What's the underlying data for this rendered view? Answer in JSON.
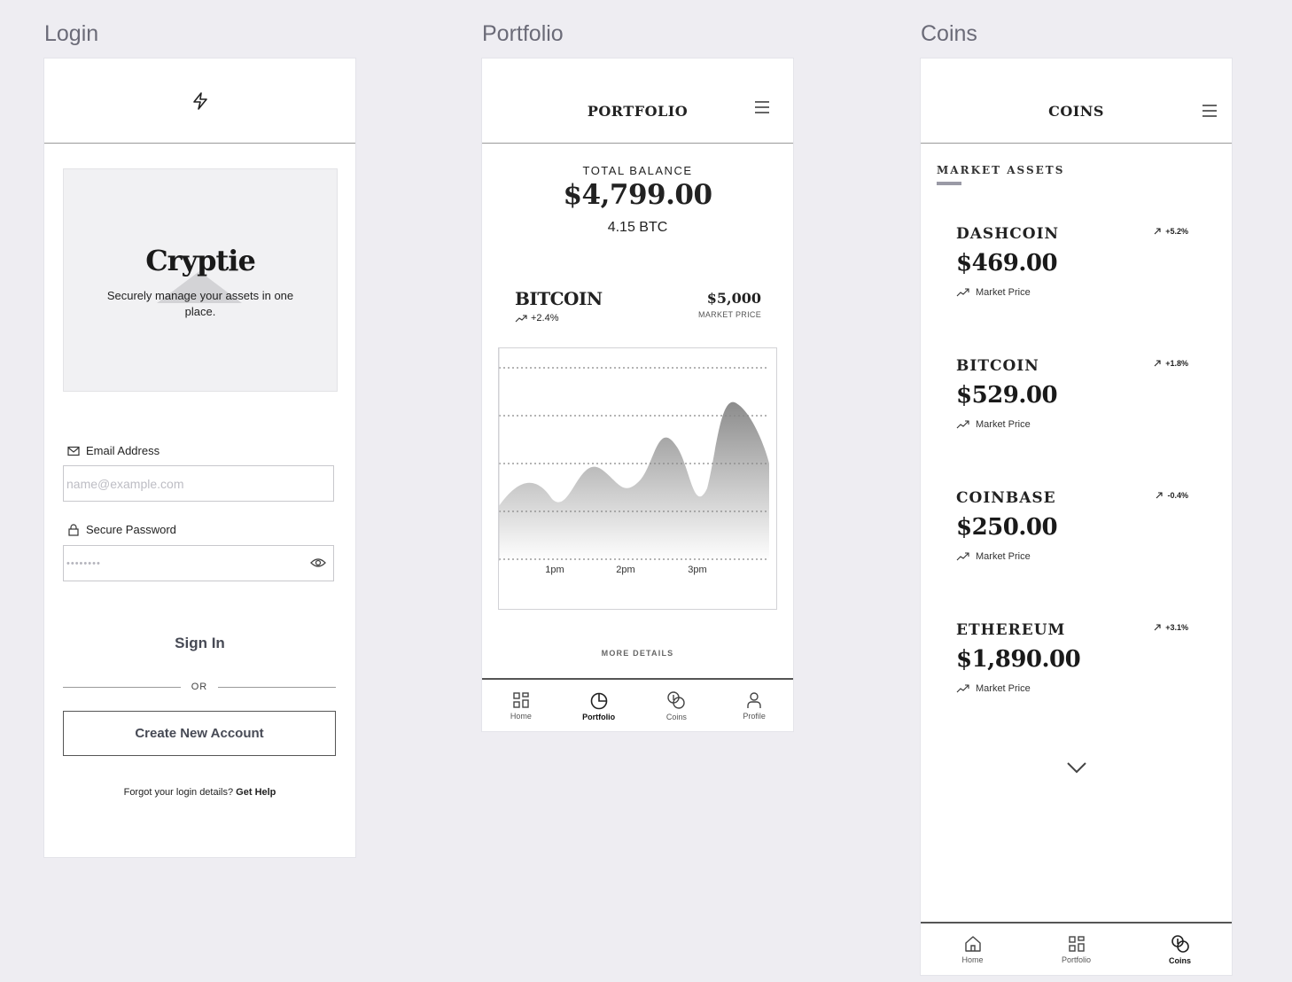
{
  "frames": {
    "login_label": "Login",
    "portfolio_label": "Portfolio",
    "coins_label": "Coins"
  },
  "login": {
    "app_name": "Cryptie",
    "tagline": "Securely manage your assets in one place.",
    "email_label": "Email Address",
    "email_placeholder": "name@example.com",
    "password_label": "Secure Password",
    "password_value": "••••••••",
    "sign_in": "Sign In",
    "or": "OR",
    "create_account": "Create New Account",
    "forgot_text": "Forgot your login details?",
    "get_help": "Get Help"
  },
  "portfolio": {
    "title": "PORTFOLIO",
    "balance_label": "TOTAL BALANCE",
    "balance_amount": "$4,799.00",
    "balance_btc": "4.15 BTC",
    "coin_name": "BITCOIN",
    "coin_change": "+2.4%",
    "coin_price": "$5,000",
    "coin_price_label": "MARKET PRICE",
    "more_details": "MORE DETAILS",
    "chart_x_labels": [
      "1pm",
      "2pm",
      "3pm"
    ],
    "nav": [
      {
        "label": "Home",
        "icon": "grid-icon"
      },
      {
        "label": "Portfolio",
        "icon": "pie-chart-icon"
      },
      {
        "label": "Coins",
        "icon": "coins-icon"
      },
      {
        "label": "Profile",
        "icon": "user-icon"
      }
    ]
  },
  "coins": {
    "title": "COINS",
    "section_title": "MARKET ASSETS",
    "market_price_label": "Market Price",
    "assets": [
      {
        "name": "DASHCOIN",
        "change": "+5.2%",
        "price": "$469.00"
      },
      {
        "name": "BITCOIN",
        "change": "+1.8%",
        "price": "$529.00"
      },
      {
        "name": "COINBASE",
        "change": "-0.4%",
        "price": "$250.00"
      },
      {
        "name": "ETHEREUM",
        "change": "+3.1%",
        "price": "$1,890.00"
      }
    ],
    "nav": [
      {
        "label": "Home",
        "icon": "home-icon"
      },
      {
        "label": "Portfolio",
        "icon": "grid-icon"
      },
      {
        "label": "Coins",
        "icon": "coins-icon"
      }
    ]
  },
  "colors": {
    "background": "#eeedf2",
    "frame": "#ffffff",
    "label": "#6b6b78",
    "accent_dark": "#474a55"
  }
}
